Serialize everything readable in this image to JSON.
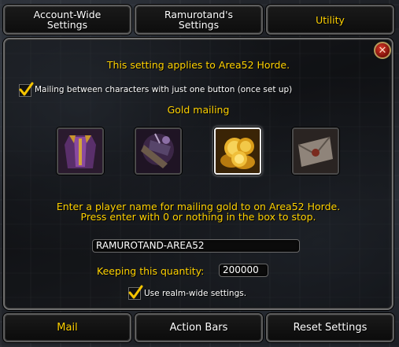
{
  "tabs": [
    {
      "label": "Account-Wide\nSettings",
      "active": false
    },
    {
      "label": "Ramurotand's\nSettings",
      "active": false
    },
    {
      "label": "Utility",
      "active": true
    }
  ],
  "panel": {
    "realm_note": "This setting applies to Area52 Horde.",
    "mailing_checkbox": {
      "label": "Mailing between characters with just one button (once set up)",
      "checked": true
    },
    "gold_mailing_title": "Gold mailing",
    "icons": [
      {
        "name": "purple-tabard-icon",
        "selected": false
      },
      {
        "name": "dark-bundle-icon",
        "selected": false
      },
      {
        "name": "gold-coins-icon",
        "selected": true
      },
      {
        "name": "envelope-icon",
        "selected": false
      }
    ],
    "instructions_line1": "Enter a player name for mailing gold to on Area52 Horde.",
    "instructions_line2": "Press enter with 0 or nothing in the box to stop.",
    "recipient_value": "RAMUROTAND-AREA52",
    "keeping_label": "Keeping this quantity:",
    "keeping_value": "200000",
    "realm_wide_checkbox": {
      "label": "Use realm-wide settings.",
      "checked": true
    }
  },
  "bottom_buttons": [
    {
      "label": "Mail",
      "active": true
    },
    {
      "label": "Action Bars",
      "active": false
    },
    {
      "label": "Reset Settings",
      "active": false
    }
  ],
  "colors": {
    "accent_gold": "#ffd200",
    "text_white": "#ffffff",
    "close_red": "#c0281a"
  }
}
